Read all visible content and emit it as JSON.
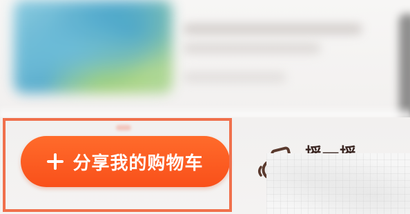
{
  "actions": {
    "share_cart": {
      "label": "分享我的购物车",
      "icon": "plus-icon"
    },
    "shake": {
      "label": "摇一摇",
      "icon": "phone-shake-icon"
    }
  },
  "colors": {
    "share_button_bg": "#f9501a",
    "highlight_frame": "#f0704c",
    "shake_label": "#3a2622",
    "shake_icon": "#5a3a2e"
  }
}
